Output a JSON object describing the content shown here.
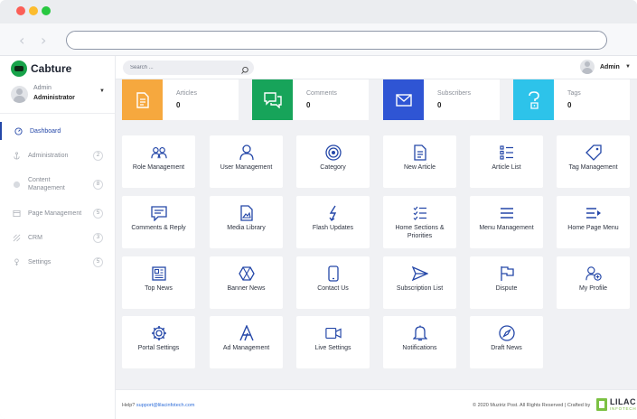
{
  "brand": {
    "name": "Cabture"
  },
  "profile": {
    "name": "Admin",
    "role": "Administrator"
  },
  "sidebar": {
    "items": [
      {
        "label": "Dashboard",
        "badge": ""
      },
      {
        "label": "Administration",
        "badge": "2"
      },
      {
        "label": "Content Management",
        "badge": "8"
      },
      {
        "label": "Page Management",
        "badge": "5"
      },
      {
        "label": "CRM",
        "badge": "3"
      },
      {
        "label": "Settings",
        "badge": "5"
      }
    ]
  },
  "topbar": {
    "search_placeholder": "Search ...",
    "user_label": "Admin"
  },
  "stats": [
    {
      "label": "Articles",
      "value": "0",
      "color": "#f6a83e",
      "icon": "document-icon"
    },
    {
      "label": "Comments",
      "value": "0",
      "color": "#17a45a",
      "icon": "chat-icon"
    },
    {
      "label": "Subscribers",
      "value": "0",
      "color": "#2f55d4",
      "icon": "mail-icon"
    },
    {
      "label": "Tags",
      "value": "0",
      "color": "#2dc3ea",
      "icon": "question-icon"
    }
  ],
  "modules": [
    {
      "label": "Role Management",
      "icon": "users-icon"
    },
    {
      "label": "User Management",
      "icon": "user-icon"
    },
    {
      "label": "Category",
      "icon": "target-icon"
    },
    {
      "label": "New Article",
      "icon": "document-icon"
    },
    {
      "label": "Article List",
      "icon": "list-icon"
    },
    {
      "label": "Tag Management",
      "icon": "tag-icon"
    },
    {
      "label": "Comments & Reply",
      "icon": "comment-icon"
    },
    {
      "label": "Media Library",
      "icon": "image-icon"
    },
    {
      "label": "Flash Updates",
      "icon": "lightning-icon"
    },
    {
      "label": "Home Sections & Priorities",
      "icon": "checklist-icon"
    },
    {
      "label": "Menu Management",
      "icon": "menu-icon"
    },
    {
      "label": "Home Page Menu",
      "icon": "menu-arrow-icon"
    },
    {
      "label": "Top News",
      "icon": "newspaper-icon"
    },
    {
      "label": "Banner News",
      "icon": "banner-icon"
    },
    {
      "label": "Contact Us",
      "icon": "phone-icon"
    },
    {
      "label": "Subscription List",
      "icon": "send-icon"
    },
    {
      "label": "Dispute",
      "icon": "flag-icon"
    },
    {
      "label": "My Profile",
      "icon": "user-plus-icon"
    },
    {
      "label": "Portal Settings",
      "icon": "gear-icon"
    },
    {
      "label": "Ad Management",
      "icon": "ad-icon"
    },
    {
      "label": "Live Settings",
      "icon": "video-icon"
    },
    {
      "label": "Notifications",
      "icon": "bell-icon"
    },
    {
      "label": "Draft News",
      "icon": "compass-icon"
    }
  ],
  "footer": {
    "help_label": "Help?",
    "help_email": "support@lilacinfotech.com",
    "copyright": "© 2020 Muziriz Post. All Rights Reserved | Crafted by",
    "maker": "LILAC",
    "maker_sub": "INFOTECH"
  },
  "colors": {
    "accent": "#2447a8",
    "icon": "#2447a8"
  }
}
